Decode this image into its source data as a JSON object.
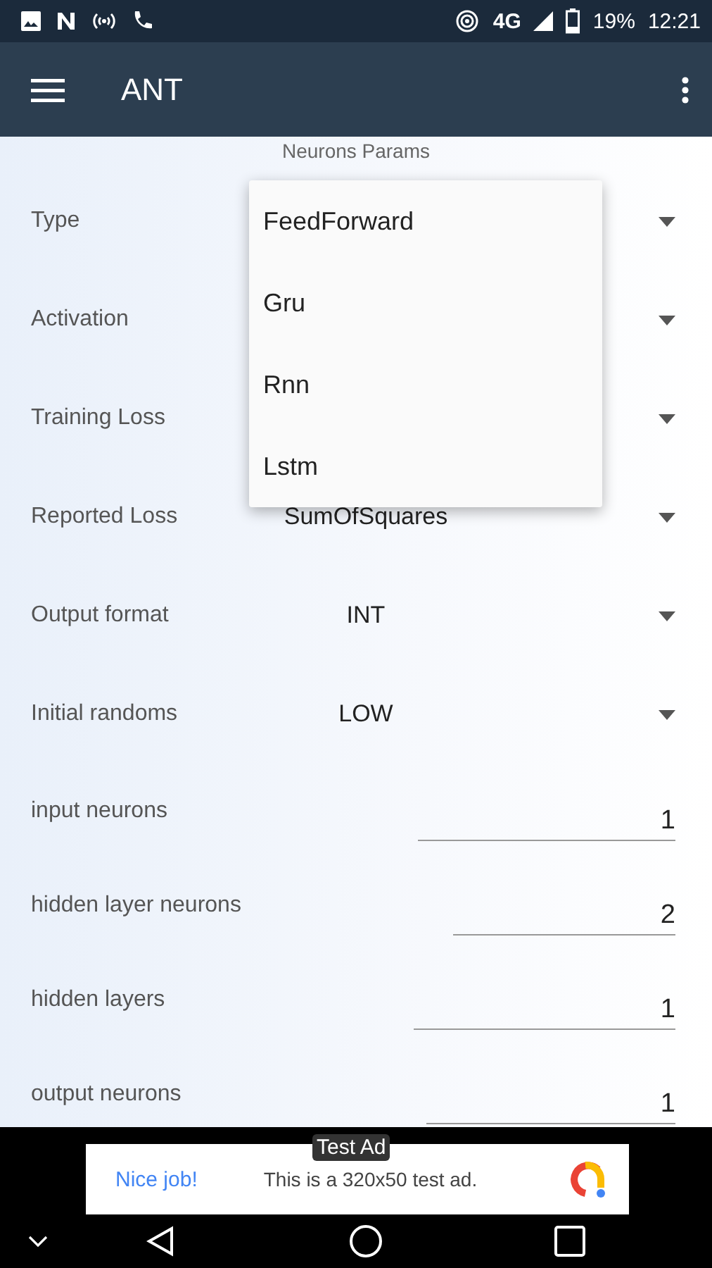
{
  "status_bar": {
    "battery": "19%",
    "time": "12:21",
    "network": "4G"
  },
  "app_bar": {
    "title": "ANT"
  },
  "form": {
    "heading": "Neurons Params",
    "rows": [
      {
        "kind": "spinner",
        "label": "Type"
      },
      {
        "kind": "spinner",
        "label": "Activation"
      },
      {
        "kind": "spinner",
        "label": "Training Loss"
      },
      {
        "kind": "spinner",
        "label": "Reported Loss",
        "value": "SumOfSquares"
      },
      {
        "kind": "spinner",
        "label": "Output format",
        "value": "INT"
      },
      {
        "kind": "spinner",
        "label": "Initial randoms",
        "value": "LOW"
      },
      {
        "kind": "field",
        "label": "input neurons",
        "value": "1"
      },
      {
        "kind": "field",
        "label": "hidden layer neurons",
        "value": "2"
      },
      {
        "kind": "field",
        "label": "hidden layers",
        "value": "1"
      },
      {
        "kind": "field",
        "label": "output neurons",
        "value": "1"
      }
    ]
  },
  "dropdown_menu": {
    "items": [
      {
        "label": "FeedForward"
      },
      {
        "label": "Gru"
      },
      {
        "label": "Rnn"
      },
      {
        "label": "Lstm"
      }
    ]
  },
  "ad": {
    "badge": "Test Ad",
    "headline": "Nice job!",
    "text": "This is a 320x50 test ad."
  }
}
